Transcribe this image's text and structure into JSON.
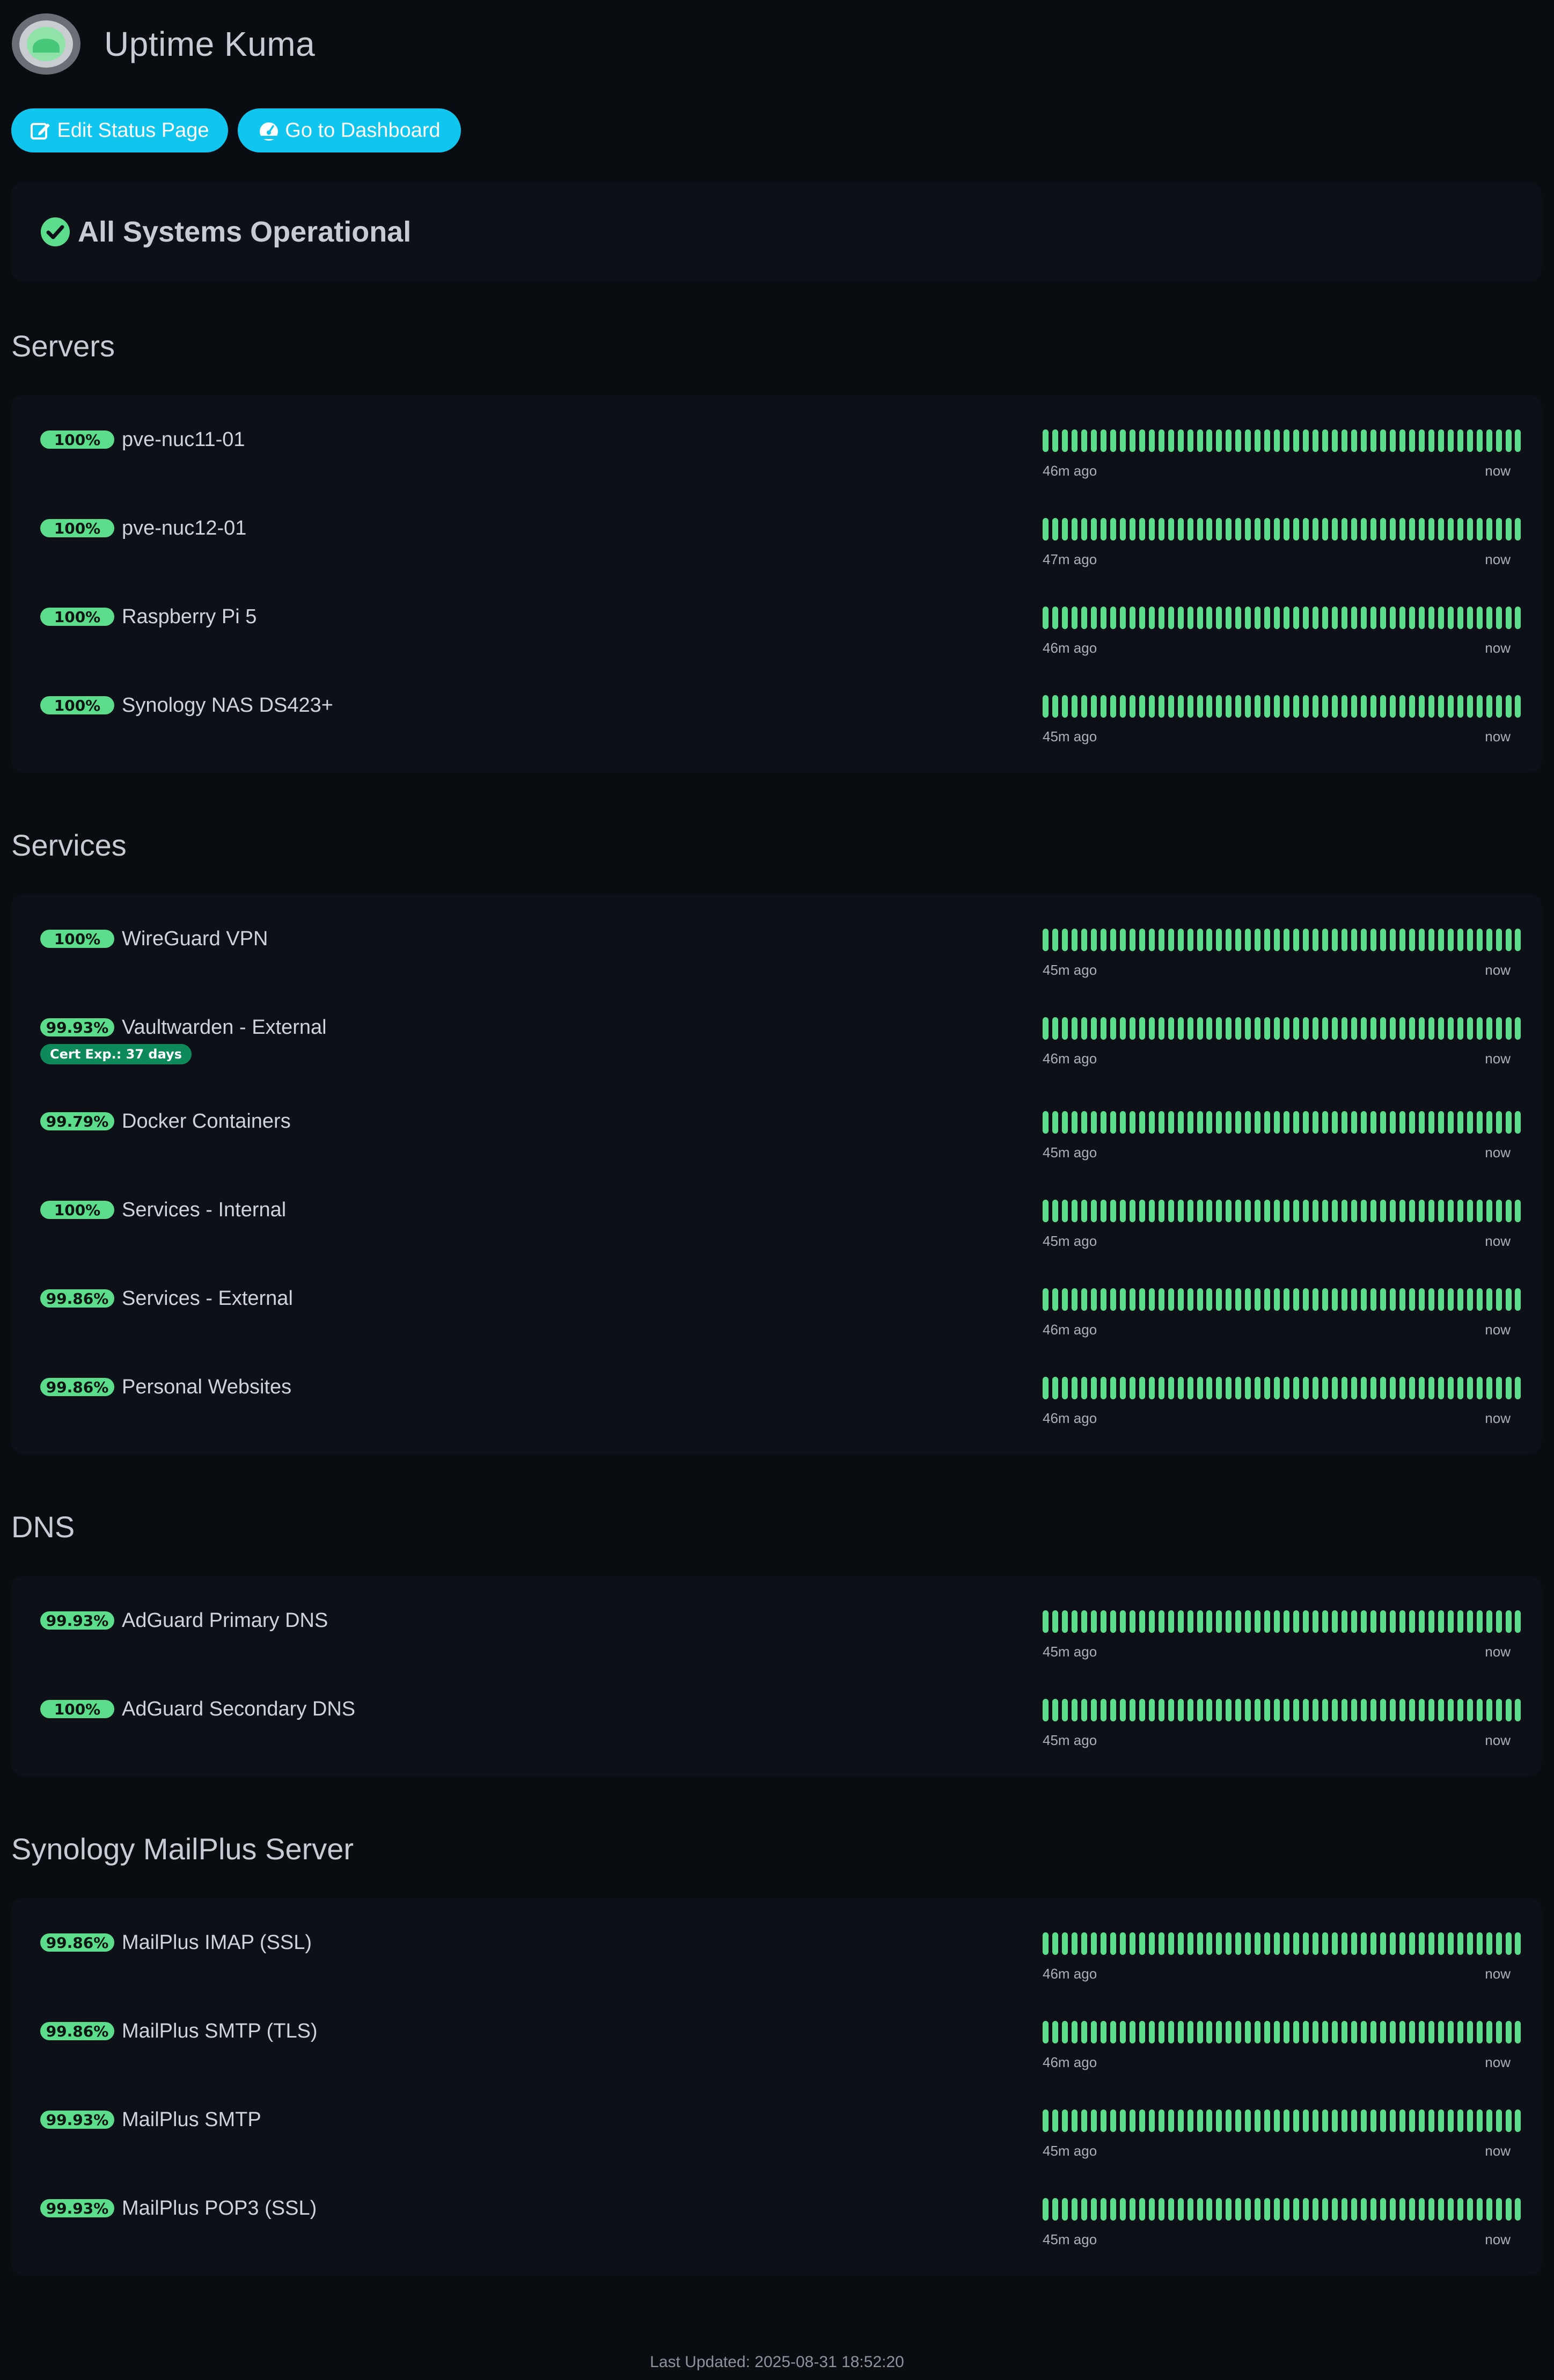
{
  "app": {
    "title": "Uptime Kuma"
  },
  "actions": {
    "edit_label": "Edit Status Page",
    "dashboard_label": "Go to Dashboard"
  },
  "overall_status": {
    "text": "All Systems Operational"
  },
  "colors": {
    "background": "#090c10",
    "card": "#0d1117",
    "accent": "#10c6ee",
    "up": "#5cdd8b",
    "cert_badge": "#0e8a5a"
  },
  "beats_per_monitor": 50,
  "groups": [
    {
      "title": "Servers",
      "monitors": [
        {
          "uptime": "100%",
          "name": "pve-nuc11-01",
          "since": "46m ago",
          "now": "now"
        },
        {
          "uptime": "100%",
          "name": "pve-nuc12-01",
          "since": "47m ago",
          "now": "now"
        },
        {
          "uptime": "100%",
          "name": "Raspberry Pi 5",
          "since": "46m ago",
          "now": "now"
        },
        {
          "uptime": "100%",
          "name": "Synology NAS DS423+",
          "since": "45m ago",
          "now": "now"
        }
      ]
    },
    {
      "title": "Services",
      "monitors": [
        {
          "uptime": "100%",
          "name": "WireGuard VPN",
          "since": "45m ago",
          "now": "now"
        },
        {
          "uptime": "99.93%",
          "name": "Vaultwarden - External",
          "cert": "Cert Exp.: 37 days",
          "since": "46m ago",
          "now": "now"
        },
        {
          "uptime": "99.79%",
          "name": "Docker Containers",
          "since": "45m ago",
          "now": "now"
        },
        {
          "uptime": "100%",
          "name": "Services - Internal",
          "since": "45m ago",
          "now": "now"
        },
        {
          "uptime": "99.86%",
          "name": "Services - External",
          "since": "46m ago",
          "now": "now"
        },
        {
          "uptime": "99.86%",
          "name": "Personal Websites",
          "since": "46m ago",
          "now": "now"
        }
      ]
    },
    {
      "title": "DNS",
      "monitors": [
        {
          "uptime": "99.93%",
          "name": "AdGuard Primary DNS",
          "since": "45m ago",
          "now": "now"
        },
        {
          "uptime": "100%",
          "name": "AdGuard Secondary DNS",
          "since": "45m ago",
          "now": "now"
        }
      ]
    },
    {
      "title": "Synology MailPlus Server",
      "monitors": [
        {
          "uptime": "99.86%",
          "name": "MailPlus IMAP (SSL)",
          "since": "46m ago",
          "now": "now"
        },
        {
          "uptime": "99.86%",
          "name": "MailPlus SMTP (TLS)",
          "since": "46m ago",
          "now": "now"
        },
        {
          "uptime": "99.93%",
          "name": "MailPlus SMTP",
          "since": "45m ago",
          "now": "now"
        },
        {
          "uptime": "99.93%",
          "name": "MailPlus POP3 (SSL)",
          "since": "45m ago",
          "now": "now"
        }
      ]
    }
  ],
  "footer": {
    "last_updated": "Last Updated: 2025-08-31 18:52:20"
  }
}
